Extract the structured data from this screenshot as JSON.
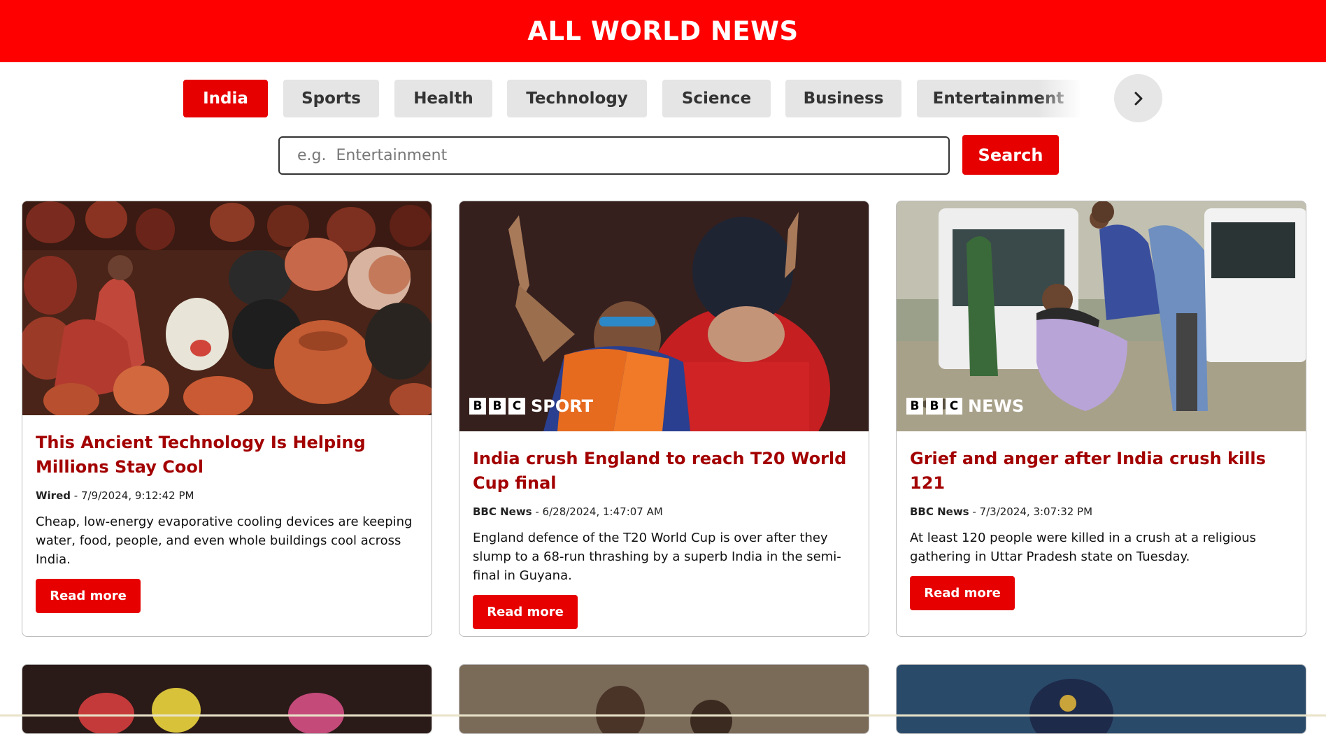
{
  "header": {
    "title": "ALL WORLD NEWS",
    "bg": "#ff0000"
  },
  "categories": {
    "items": [
      {
        "label": "India",
        "active": true
      },
      {
        "label": "Sports",
        "active": false
      },
      {
        "label": "Health",
        "active": false
      },
      {
        "label": "Technology",
        "active": false
      },
      {
        "label": "Science",
        "active": false
      },
      {
        "label": "Business",
        "active": false
      },
      {
        "label": "Entertainment",
        "active": false
      }
    ],
    "next_icon": "chevron-right-icon"
  },
  "search": {
    "placeholder": "e.g.  Entertainment",
    "value": "",
    "button_label": "Search"
  },
  "articles": [
    {
      "title": "This Ancient Technology Is Helping Millions Stay Cool",
      "source": "Wired",
      "date": " - 7/9/2024, 9:12:42 PM",
      "description": "Cheap, low-energy evaporative cooling devices are keeping water, food, people, and even whole buildings cool across India.",
      "read_label": "Read more",
      "image": "clay-pots-photo"
    },
    {
      "title": "India crush England to reach T20 World Cup final",
      "source": "BBC News",
      "date": " - 6/28/2024, 1:47:07 AM",
      "description": "England defence of the T20 World Cup is over after they slump to a 68-run thrashing by a superb India in the semi-final in Guyana.",
      "read_label": "Read more",
      "image": "cricket-celebration-photo",
      "logo_letters": [
        "B",
        "B",
        "C"
      ],
      "logo_word": "SPORT"
    },
    {
      "title": "Grief and anger after India crush kills 121",
      "source": "BBC News",
      "date": " - 7/3/2024, 3:07:32 PM",
      "description": "At least 120 people were killed in a crush at a religious gathering in Uttar Pradesh state on Tuesday.",
      "read_label": "Read more",
      "image": "grieving-people-ambulance-photo",
      "logo_letters": [
        "B",
        "B",
        "C"
      ],
      "logo_word": "NEWS"
    }
  ],
  "colors": {
    "accent": "#e60000",
    "title_red": "#a30000",
    "chip_bg": "#e5e5e5"
  }
}
